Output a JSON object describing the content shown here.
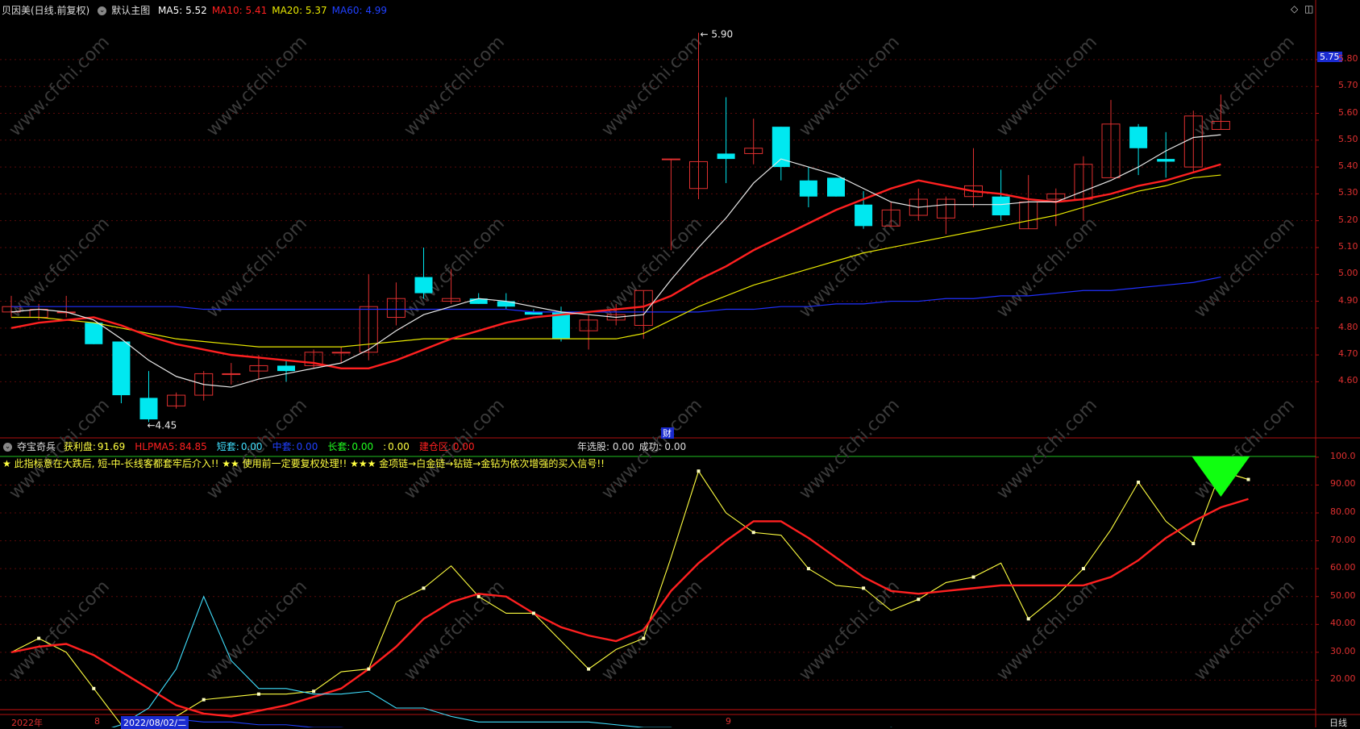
{
  "main": {
    "stock_name": "贝因美(日线.前复权)",
    "template": "默认主图",
    "ma": [
      {
        "label": "MA5:",
        "value": "5.52",
        "color": "#ffffff"
      },
      {
        "label": "MA10:",
        "value": "5.41",
        "color": "#ff2020"
      },
      {
        "label": "MA20:",
        "value": "5.37",
        "color": "#e8e800"
      },
      {
        "label": "MA60:",
        "value": "4.99",
        "color": "#2040ff"
      }
    ],
    "high_label": "5.90",
    "low_label": "4.45",
    "current_price_tag": "5.75",
    "finance_marker": "财",
    "y_ticks": [
      "5.80",
      "5.70",
      "5.60",
      "5.50",
      "5.40",
      "5.30",
      "5.20",
      "5.10",
      "5.00",
      "4.90",
      "4.80",
      "4.70",
      "4.60"
    ]
  },
  "indicator": {
    "name": "夺宝奇兵",
    "items": [
      {
        "label": "获利盘:",
        "value": "91.69",
        "color": "#ffff40"
      },
      {
        "label": "HLPMA5:",
        "value": "84.85",
        "color": "#ff2020"
      },
      {
        "label": "短套:",
        "value": "0.00",
        "color": "#40e0ff"
      },
      {
        "label": "中套:",
        "value": "0.00",
        "color": "#2040ff"
      },
      {
        "label": "长套:",
        "value": "0.00",
        "color": "#20ff20"
      },
      {
        "label": ":",
        "value": "0.00",
        "color": "#ffff40"
      },
      {
        "label": "建仓区:",
        "value": "0.00",
        "color": "#ff2020"
      }
    ],
    "extra": [
      {
        "label": "年选股:",
        "value": "0.00"
      },
      {
        "label": "成功:",
        "value": "0.00"
      }
    ],
    "notes": "★ 此指标意在大跌后, 短-中-长线客都套牢后介入!!   ★★ 使用前一定要复权处理!!   ★★★ 金项链→白金链→钻链→金钻为依次增强的买入信号!!",
    "y_ticks": [
      "100.0",
      "90.00",
      "80.00",
      "70.00",
      "60.00",
      "50.00",
      "40.00",
      "30.00",
      "20.00"
    ]
  },
  "x_axis": {
    "year": "2022年",
    "month_a": "8",
    "date_cursor": "2022/08/02/二",
    "month_b": "9",
    "period": "日线"
  },
  "chart_data": [
    {
      "type": "candlestick",
      "title": "贝因美(日线.前复权)",
      "ylim": [
        4.4,
        5.95
      ],
      "candles": [
        {
          "o": 4.86,
          "h": 4.92,
          "l": 4.84,
          "c": 4.88
        },
        {
          "o": 4.84,
          "h": 4.89,
          "l": 4.83,
          "c": 4.87
        },
        {
          "o": 4.86,
          "h": 4.92,
          "l": 4.84,
          "c": 4.86
        },
        {
          "o": 4.82,
          "h": 4.82,
          "l": 4.74,
          "c": 4.74
        },
        {
          "o": 4.75,
          "h": 4.75,
          "l": 4.52,
          "c": 4.55
        },
        {
          "o": 4.54,
          "h": 4.64,
          "l": 4.45,
          "c": 4.46
        },
        {
          "o": 4.51,
          "h": 4.56,
          "l": 4.5,
          "c": 4.55
        },
        {
          "o": 4.55,
          "h": 4.64,
          "l": 4.53,
          "c": 4.63
        },
        {
          "o": 4.63,
          "h": 4.67,
          "l": 4.59,
          "c": 4.63
        },
        {
          "o": 4.64,
          "h": 4.7,
          "l": 4.61,
          "c": 4.66
        },
        {
          "o": 4.66,
          "h": 4.68,
          "l": 4.6,
          "c": 4.64
        },
        {
          "o": 4.66,
          "h": 4.72,
          "l": 4.65,
          "c": 4.71
        },
        {
          "o": 4.71,
          "h": 4.73,
          "l": 4.67,
          "c": 4.71
        },
        {
          "o": 4.71,
          "h": 5.0,
          "l": 4.68,
          "c": 4.88
        },
        {
          "o": 4.84,
          "h": 4.97,
          "l": 4.81,
          "c": 4.91
        },
        {
          "o": 4.99,
          "h": 5.1,
          "l": 4.91,
          "c": 4.93
        },
        {
          "o": 4.9,
          "h": 5.02,
          "l": 4.89,
          "c": 4.91
        },
        {
          "o": 4.91,
          "h": 4.93,
          "l": 4.89,
          "c": 4.89
        },
        {
          "o": 4.9,
          "h": 4.93,
          "l": 4.87,
          "c": 4.88
        },
        {
          "o": 4.86,
          "h": 4.87,
          "l": 4.85,
          "c": 4.85
        },
        {
          "o": 4.86,
          "h": 4.88,
          "l": 4.75,
          "c": 4.76
        },
        {
          "o": 4.79,
          "h": 4.85,
          "l": 4.72,
          "c": 4.83
        },
        {
          "o": 4.83,
          "h": 4.89,
          "l": 4.81,
          "c": 4.85
        },
        {
          "o": 4.81,
          "h": 4.94,
          "l": 4.76,
          "c": 4.94
        },
        {
          "o": 5.43,
          "h": 5.43,
          "l": 5.09,
          "c": 5.43
        },
        {
          "o": 5.32,
          "h": 5.9,
          "l": 5.28,
          "c": 5.42
        },
        {
          "o": 5.45,
          "h": 5.66,
          "l": 5.34,
          "c": 5.43
        },
        {
          "o": 5.45,
          "h": 5.58,
          "l": 5.41,
          "c": 5.47
        },
        {
          "o": 5.55,
          "h": 5.55,
          "l": 5.35,
          "c": 5.4
        },
        {
          "o": 5.35,
          "h": 5.4,
          "l": 5.25,
          "c": 5.29
        },
        {
          "o": 5.36,
          "h": 5.36,
          "l": 5.29,
          "c": 5.29
        },
        {
          "o": 5.26,
          "h": 5.31,
          "l": 5.17,
          "c": 5.18
        },
        {
          "o": 5.18,
          "h": 5.27,
          "l": 5.18,
          "c": 5.24
        },
        {
          "o": 5.22,
          "h": 5.32,
          "l": 5.2,
          "c": 5.28
        },
        {
          "o": 5.21,
          "h": 5.29,
          "l": 5.15,
          "c": 5.28
        },
        {
          "o": 5.29,
          "h": 5.47,
          "l": 5.25,
          "c": 5.33
        },
        {
          "o": 5.29,
          "h": 5.39,
          "l": 5.2,
          "c": 5.22
        },
        {
          "o": 5.17,
          "h": 5.37,
          "l": 5.17,
          "c": 5.27
        },
        {
          "o": 5.28,
          "h": 5.32,
          "l": 5.18,
          "c": 5.3
        },
        {
          "o": 5.28,
          "h": 5.44,
          "l": 5.2,
          "c": 5.41
        },
        {
          "o": 5.36,
          "h": 5.65,
          "l": 5.36,
          "c": 5.56
        },
        {
          "o": 5.55,
          "h": 5.56,
          "l": 5.37,
          "c": 5.47
        },
        {
          "o": 5.43,
          "h": 5.53,
          "l": 5.36,
          "c": 5.42
        },
        {
          "o": 5.4,
          "h": 5.61,
          "l": 5.38,
          "c": 5.59
        },
        {
          "o": 5.54,
          "h": 5.67,
          "l": 5.54,
          "c": 5.57
        }
      ],
      "ma5": [
        4.86,
        4.87,
        4.86,
        4.83,
        4.76,
        4.68,
        4.62,
        4.59,
        4.58,
        4.61,
        4.63,
        4.65,
        4.67,
        4.72,
        4.79,
        4.85,
        4.88,
        4.91,
        4.9,
        4.88,
        4.86,
        4.85,
        4.84,
        4.85,
        4.98,
        5.1,
        5.21,
        5.34,
        5.43,
        5.4,
        5.37,
        5.32,
        5.27,
        5.25,
        5.26,
        5.26,
        5.26,
        5.27,
        5.27,
        5.31,
        5.35,
        5.4,
        5.46,
        5.51,
        5.52
      ],
      "ma10": [
        4.8,
        4.82,
        4.83,
        4.84,
        4.81,
        4.77,
        4.74,
        4.72,
        4.7,
        4.69,
        4.68,
        4.67,
        4.65,
        4.65,
        4.68,
        4.72,
        4.76,
        4.79,
        4.82,
        4.84,
        4.85,
        4.86,
        4.87,
        4.88,
        4.92,
        4.98,
        5.03,
        5.09,
        5.14,
        5.19,
        5.24,
        5.28,
        5.32,
        5.35,
        5.33,
        5.31,
        5.3,
        5.28,
        5.27,
        5.28,
        5.3,
        5.33,
        5.35,
        5.38,
        5.41
      ],
      "ma20": [
        4.84,
        4.84,
        4.83,
        4.82,
        4.8,
        4.78,
        4.76,
        4.75,
        4.74,
        4.73,
        4.73,
        4.73,
        4.73,
        4.74,
        4.75,
        4.76,
        4.76,
        4.76,
        4.76,
        4.76,
        4.76,
        4.76,
        4.76,
        4.78,
        4.83,
        4.88,
        4.92,
        4.96,
        4.99,
        5.02,
        5.05,
        5.08,
        5.1,
        5.12,
        5.14,
        5.16,
        5.18,
        5.2,
        5.22,
        5.25,
        5.28,
        5.31,
        5.33,
        5.36,
        5.37
      ],
      "ma60": [
        4.88,
        4.88,
        4.88,
        4.88,
        4.88,
        4.88,
        4.88,
        4.87,
        4.87,
        4.87,
        4.87,
        4.87,
        4.87,
        4.87,
        4.87,
        4.87,
        4.87,
        4.87,
        4.87,
        4.86,
        4.86,
        4.86,
        4.86,
        4.86,
        4.86,
        4.86,
        4.87,
        4.87,
        4.88,
        4.88,
        4.89,
        4.89,
        4.9,
        4.9,
        4.91,
        4.91,
        4.92,
        4.92,
        4.93,
        4.94,
        4.94,
        4.95,
        4.96,
        4.97,
        4.99
      ]
    },
    {
      "type": "line",
      "title": "夺宝奇兵",
      "ylim": [
        10,
        102
      ],
      "series": [
        {
          "name": "获利盘",
          "color": "#ffff40",
          "values": [
            30,
            35,
            30,
            17,
            4,
            3,
            7,
            13,
            14,
            15,
            15,
            16,
            23,
            24,
            48,
            53,
            61,
            50,
            44,
            44,
            34,
            24,
            31,
            35,
            64,
            95,
            80,
            73,
            72,
            60,
            54,
            53,
            45,
            49,
            55,
            57,
            62,
            42,
            50,
            60,
            74,
            91,
            77,
            69,
            95,
            92
          ]
        },
        {
          "name": "HLPMA5",
          "color": "#ff2020",
          "values": [
            30,
            32,
            33,
            29,
            23,
            17,
            11,
            8,
            7,
            9,
            11,
            14,
            17,
            24,
            32,
            42,
            48,
            51,
            50,
            44,
            39,
            36,
            34,
            38,
            52,
            62,
            70,
            77,
            77,
            71,
            64,
            57,
            52,
            51,
            52,
            53,
            54,
            54,
            54,
            54,
            57,
            63,
            71,
            77,
            82,
            85
          ]
        },
        {
          "name": "短套",
          "color": "#40e0ff",
          "values": [
            1,
            1,
            1,
            1,
            4,
            10,
            24,
            50,
            27,
            17,
            17,
            15,
            15,
            16,
            10,
            10,
            7,
            5,
            5,
            5,
            5,
            5,
            4,
            3,
            3,
            0,
            0,
            0,
            0,
            0,
            0,
            0,
            3,
            1,
            1,
            1,
            1,
            2,
            1,
            1,
            0,
            0,
            0,
            0,
            0,
            0
          ]
        },
        {
          "name": "中套",
          "color": "#2040ff",
          "values": [
            0,
            0,
            0,
            1,
            2,
            5,
            6,
            5,
            5,
            4,
            4,
            3,
            3,
            2,
            2,
            1,
            1,
            1,
            1,
            1,
            1,
            1,
            1,
            1,
            1,
            1,
            1,
            0,
            0,
            0,
            0,
            0,
            0,
            0,
            0,
            0,
            0,
            0,
            0,
            0,
            0,
            0,
            0,
            0,
            0,
            0
          ]
        }
      ]
    }
  ]
}
